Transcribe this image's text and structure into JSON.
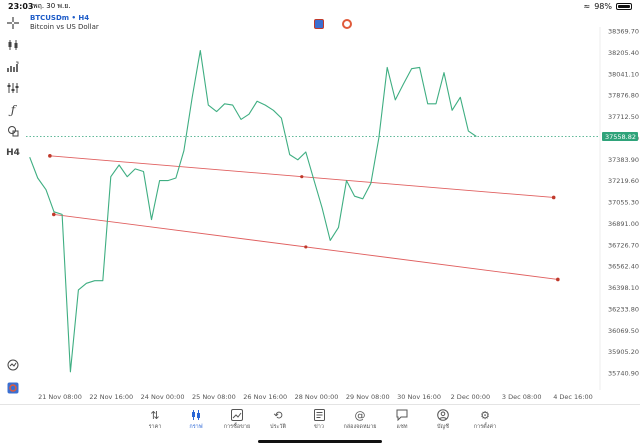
{
  "status": {
    "time": "23:03",
    "date": "พฤ. 30 พ.ย.",
    "battery": "98%",
    "battery_level": 0.98
  },
  "chart_header": {
    "symbol": "BTCUSDm • H4",
    "description": "Bitcoin vs US Dollar"
  },
  "left_tools": [
    {
      "icon": "crosshair-icon"
    },
    {
      "icon": "candles-icon"
    },
    {
      "icon": "indicators-icon"
    },
    {
      "icon": "sliders-icon"
    },
    {
      "icon": "function-icon"
    },
    {
      "icon": "shapes-icon"
    },
    {
      "label": "H4",
      "icon": "timeframe-icon"
    },
    {
      "icon": "trade-signals-icon"
    },
    {
      "icon": "exness-logo-icon"
    }
  ],
  "current_price": "37558.82",
  "chart_data": {
    "type": "line",
    "title": "",
    "y_ticks": [
      "38369.70",
      "38205.40",
      "38041.10",
      "37876.80",
      "37712.50",
      "37548.20",
      "37383.90",
      "37219.60",
      "37055.30",
      "36891.00",
      "36726.70",
      "36562.40",
      "36398.10",
      "36233.80",
      "36069.50",
      "35905.20",
      "35740.90"
    ],
    "x_ticks": [
      "21 Nov 08:00",
      "22 Nov 16:00",
      "24 Nov 00:00",
      "25 Nov 08:00",
      "26 Nov 16:00",
      "28 Nov 00:00",
      "29 Nov 08:00",
      "30 Nov 16:00",
      "2 Dec 00:00",
      "3 Dec 08:00",
      "4 Dec 16:00"
    ],
    "ylim": [
      35700,
      38450
    ],
    "price_series": [
      [
        20.0,
        37400
      ],
      [
        20.33,
        37240
      ],
      [
        20.67,
        37150
      ],
      [
        21.0,
        36980
      ],
      [
        21.33,
        36960
      ],
      [
        21.67,
        35750
      ],
      [
        22.0,
        36380
      ],
      [
        22.33,
        36430
      ],
      [
        22.67,
        36450
      ],
      [
        23.0,
        36450
      ],
      [
        23.33,
        37250
      ],
      [
        23.67,
        37340
      ],
      [
        24.0,
        37250
      ],
      [
        24.33,
        37310
      ],
      [
        24.67,
        37290
      ],
      [
        25.0,
        36920
      ],
      [
        25.33,
        37220
      ],
      [
        25.67,
        37220
      ],
      [
        26.0,
        37240
      ],
      [
        26.33,
        37450
      ],
      [
        26.67,
        37860
      ],
      [
        27.0,
        38220
      ],
      [
        27.33,
        37800
      ],
      [
        27.67,
        37750
      ],
      [
        28.0,
        37810
      ],
      [
        28.33,
        37800
      ],
      [
        28.67,
        37690
      ],
      [
        29.0,
        37730
      ],
      [
        29.33,
        37830
      ],
      [
        29.67,
        37800
      ],
      [
        30.0,
        37760
      ],
      [
        30.33,
        37700
      ],
      [
        30.67,
        37420
      ],
      [
        31.0,
        37380
      ],
      [
        31.33,
        37440
      ],
      [
        31.67,
        37220
      ],
      [
        32.0,
        37010
      ],
      [
        32.33,
        36760
      ],
      [
        32.67,
        36860
      ],
      [
        33.0,
        37220
      ],
      [
        33.33,
        37100
      ],
      [
        33.67,
        37080
      ],
      [
        34.0,
        37200
      ],
      [
        34.33,
        37550
      ],
      [
        34.67,
        38090
      ],
      [
        35.0,
        37840
      ],
      [
        35.33,
        37960
      ],
      [
        35.67,
        38080
      ],
      [
        36.0,
        38090
      ],
      [
        36.33,
        37810
      ],
      [
        36.67,
        37810
      ],
      [
        37.0,
        38050
      ],
      [
        37.33,
        37760
      ],
      [
        37.67,
        37860
      ],
      [
        38.0,
        37600
      ],
      [
        38.33,
        37558.82
      ]
    ],
    "trendlines": [
      {
        "from": [
          20.83,
          37410
        ],
        "to": [
          41.5,
          37090
        ]
      },
      {
        "from": [
          20.99,
          36960
        ],
        "to": [
          41.67,
          36460
        ]
      }
    ],
    "x_range": [
      19.85,
      43.4
    ],
    "grid": false,
    "line_color": "#3fae82",
    "trendline_color": "#e06060",
    "price_line_color": "#2fa37a"
  },
  "tabs": [
    {
      "label": "ราคา",
      "icon": "arrows-updown-icon",
      "active": false
    },
    {
      "label": "กราฟ",
      "icon": "candles-icon",
      "active": true
    },
    {
      "label": "การซื้อขาย",
      "icon": "trend-chart-icon",
      "active": false
    },
    {
      "label": "ประวัติ",
      "icon": "history-icon",
      "active": false
    },
    {
      "label": "ข่าว",
      "icon": "news-icon",
      "active": false
    },
    {
      "label": "กล่องจดหมาย",
      "icon": "at-icon",
      "active": false
    },
    {
      "label": "แชท",
      "icon": "chat-icon",
      "active": false
    },
    {
      "label": "บัญชี",
      "icon": "account-icon",
      "active": false
    },
    {
      "label": "การตั้งค่า",
      "icon": "gear-icon",
      "active": false
    }
  ],
  "colors": {
    "accent": "#2a66d6"
  }
}
